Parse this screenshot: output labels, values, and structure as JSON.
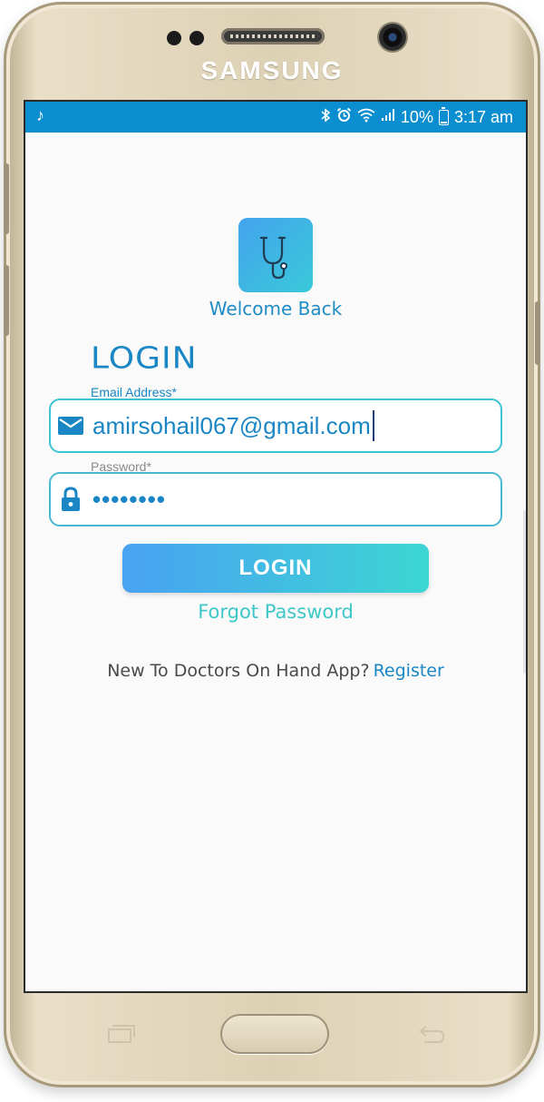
{
  "device": {
    "brand": "SAMSUNG"
  },
  "statusbar": {
    "battery_percent": "10%",
    "time": "3:17 am",
    "icons": [
      "music-note-icon",
      "bluetooth-icon",
      "alarm-icon",
      "wifi-icon",
      "signal-icon",
      "battery-icon"
    ]
  },
  "app": {
    "welcome_text": "Welcome Back",
    "login_heading": "LOGIN",
    "email": {
      "label": "Email Address*",
      "value": "amirsohail067@gmail.com"
    },
    "password": {
      "label": "Password*",
      "value_masked": "••••••••"
    },
    "login_button": "LOGIN",
    "forgot_password": "Forgot Password",
    "register_prompt": "New To Doctors On Hand App?",
    "register_link": "Register"
  },
  "colors": {
    "status_bar": "#0a8ed0",
    "primary_blue": "#1a86c4",
    "accent_teal": "#3ec7c9",
    "button_gradient_start": "#48a2f2",
    "button_gradient_end": "#3cd6d3"
  }
}
